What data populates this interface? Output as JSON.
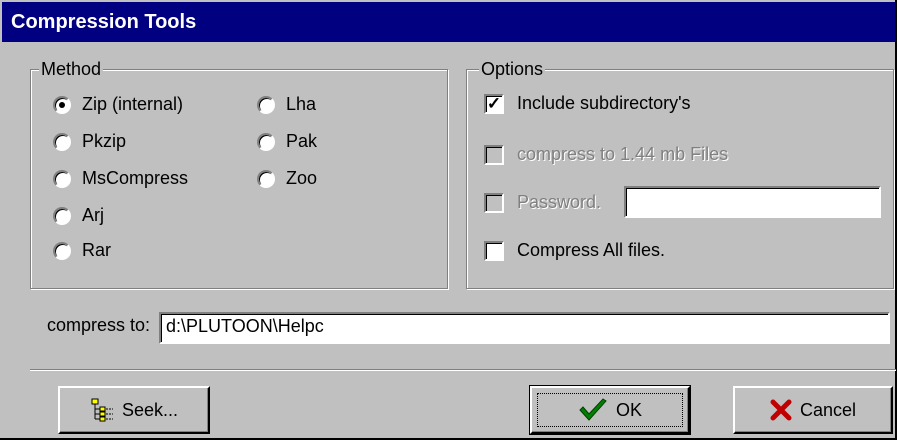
{
  "window": {
    "title": "Compression Tools"
  },
  "method": {
    "legend": "Method",
    "options": [
      {
        "label": "Zip (internal)",
        "checked": true
      },
      {
        "label": "Pkzip",
        "checked": false
      },
      {
        "label": "MsCompress",
        "checked": false
      },
      {
        "label": "Arj",
        "checked": false
      },
      {
        "label": "Rar",
        "checked": false
      },
      {
        "label": "Lha",
        "checked": false
      },
      {
        "label": "Pak",
        "checked": false
      },
      {
        "label": "Zoo",
        "checked": false
      }
    ]
  },
  "options": {
    "legend": "Options",
    "include_subdirs": {
      "label": "Include subdirectory's",
      "checked": true,
      "enabled": true
    },
    "compress_144": {
      "label": "compress to 1.44 mb Files",
      "checked": false,
      "enabled": false
    },
    "password": {
      "label": "Password.",
      "checked": false,
      "enabled": false,
      "value": ""
    },
    "compress_all": {
      "label": "Compress All files.",
      "checked": false,
      "enabled": true
    }
  },
  "compress_to": {
    "label": "compress to:",
    "value": "d:\\PLUTOON\\Helpc"
  },
  "buttons": {
    "seek": "Seek...",
    "ok": "OK",
    "cancel": "Cancel"
  },
  "icons": {
    "seek": "tree-icon",
    "ok": "green-checkmark-icon",
    "cancel": "red-x-icon"
  },
  "colors": {
    "titlebar": "#000080",
    "face": "#c0c0c0",
    "ok_check": "#008000",
    "cancel_x": "#c00000"
  }
}
